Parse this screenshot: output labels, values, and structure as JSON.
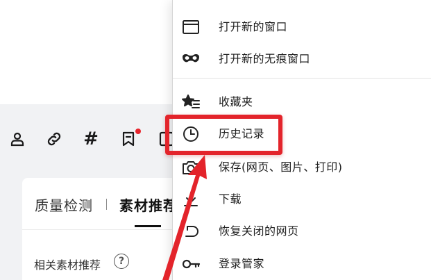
{
  "background": {
    "toolbar_icons": [
      "person-icon",
      "link-icon",
      "hash-icon",
      "bookmark-icon",
      "edit-icon"
    ],
    "hash_glyph": "#",
    "card": {
      "tab_quality": "质量检测",
      "tab_separator": "|",
      "tab_material": "素材推荐",
      "related_label": "相关素材推荐",
      "help_glyph": "?"
    }
  },
  "menu": {
    "items": [
      {
        "label": "打开新的窗口",
        "icon": "window-icon"
      },
      {
        "label": "打开新的无痕窗口",
        "icon": "incognito-mask-icon"
      },
      {
        "label": "收藏夹",
        "icon": "favorites-star-icon"
      },
      {
        "label": "历史记录",
        "icon": "history-clock-icon"
      },
      {
        "label": "保存(网页、图片、打印)",
        "icon": "camera-save-icon"
      },
      {
        "label": "下载",
        "icon": "download-icon"
      },
      {
        "label": "恢复关闭的网页",
        "icon": "restore-tab-icon"
      },
      {
        "label": "登录管家",
        "icon": "key-icon"
      }
    ]
  },
  "colors": {
    "highlight": "#e3242b",
    "notification_dot": "#e8252c",
    "page_band": "#f1f2f4"
  }
}
